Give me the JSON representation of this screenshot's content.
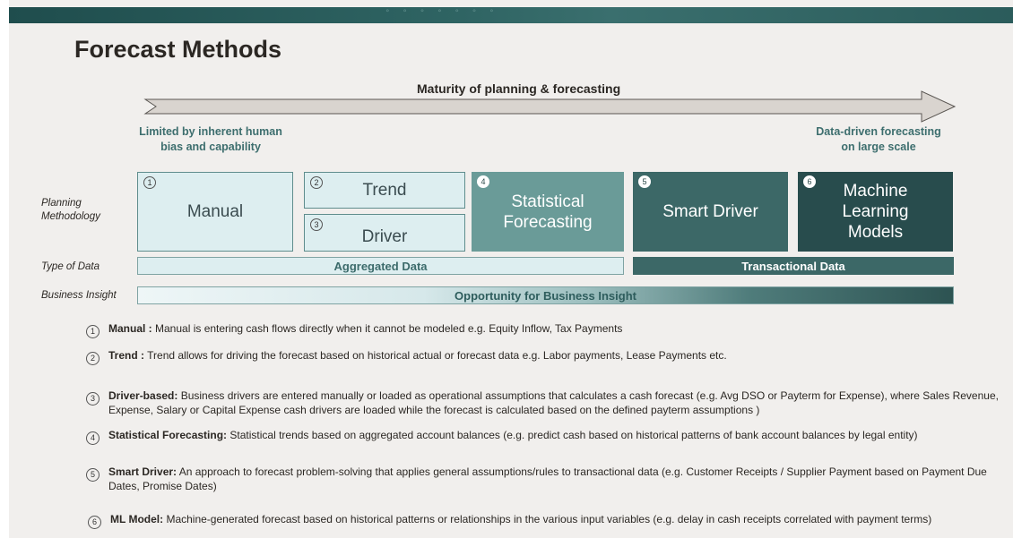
{
  "title": "Forecast Methods",
  "maturity_label": "Maturity of planning & forecasting",
  "left_label_line1": "Limited by inherent human",
  "left_label_line2": "bias and capability",
  "right_label_line1": "Data-driven forecasting",
  "right_label_line2": "on large scale",
  "row_labels": {
    "planning_line1": "Planning",
    "planning_line2": "Methodology",
    "type_of_data": "Type of Data",
    "business_insight": "Business Insight"
  },
  "methods": [
    {
      "num": "1",
      "label": "Manual"
    },
    {
      "num": "2",
      "label": "Trend"
    },
    {
      "num": "3",
      "label": "Driver"
    },
    {
      "num": "4",
      "label_line1": "Statistical",
      "label_line2": "Forecasting"
    },
    {
      "num": "5",
      "label": "Smart Driver"
    },
    {
      "num": "6",
      "label_line1": "Machine",
      "label_line2": "Learning",
      "label_line3": "Models"
    }
  ],
  "data_types": {
    "aggregated": "Aggregated Data",
    "transactional": "Transactional Data"
  },
  "opportunity": "Opportunity for Business Insight",
  "descriptions": [
    {
      "num": "1",
      "term": "Manual :",
      "text": " Manual is entering cash flows directly when it cannot be modeled e.g. Equity Inflow, Tax Payments"
    },
    {
      "num": "2",
      "term": "Trend :",
      "text": " Trend allows for driving the forecast based on historical actual or forecast data e.g. Labor payments, Lease Payments etc."
    },
    {
      "num": "3",
      "term": "Driver-based:",
      "text": " Business drivers are entered manually or loaded as operational assumptions that calculates a cash forecast (e.g. Avg DSO or Payterm for Expense), where Sales Revenue, Expense, Salary or Capital Expense cash drivers are loaded while the forecast is calculated based on the defined payterm assumptions )"
    },
    {
      "num": "4",
      "term": "Statistical Forecasting:",
      "text": " Statistical trends based on aggregated account balances (e.g. predict cash based on historical patterns of bank account balances by legal entity)"
    },
    {
      "num": "5",
      "term": "Smart Driver:",
      "text": " An approach to forecast problem-solving that applies general assumptions/rules to transactional data (e.g. Customer Receipts / Supplier Payment based on Payment Due Dates, Promise Dates)"
    },
    {
      "num": "6",
      "term": "ML Model:",
      "text": " Machine-generated forecast based on historical patterns or relationships in the various input variables (e.g. delay in cash receipts correlated with payment terms)"
    }
  ],
  "colors": {
    "accent_teal": "#3c6e6e",
    "light_box": "#ddeef0",
    "mid_box": "#6a9b98",
    "dark_box": "#3c6867",
    "darker_box": "#284c4d"
  }
}
